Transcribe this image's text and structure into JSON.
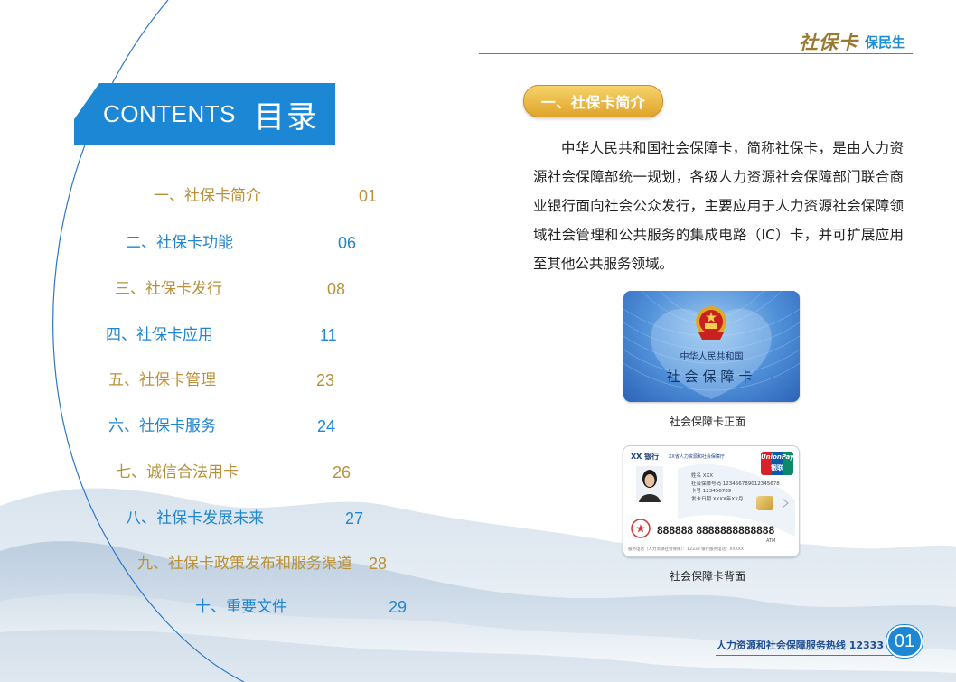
{
  "header": {
    "brand_script": "社保卡",
    "brand_tag": "保民生"
  },
  "contents": {
    "title_en": "CONTENTS",
    "title_zh": "目录",
    "items": [
      {
        "title": "一、社保卡简介",
        "page": "01",
        "color": "gold"
      },
      {
        "title": "二、社保卡功能",
        "page": "06",
        "color": "blue"
      },
      {
        "title": "三、社保卡发行",
        "page": "08",
        "color": "gold"
      },
      {
        "title": "四、社保卡应用",
        "page": "11",
        "color": "blue"
      },
      {
        "title": "五、社保卡管理",
        "page": "23",
        "color": "gold"
      },
      {
        "title": "六、社保卡服务",
        "page": "24",
        "color": "blue"
      },
      {
        "title": "七、诚信合法用卡",
        "page": "26",
        "color": "gold"
      },
      {
        "title": "八、社保卡发展未来",
        "page": "27",
        "color": "blue"
      },
      {
        "title": "九、社保卡政策发布和服务渠道",
        "page": "28",
        "color": "gold"
      },
      {
        "title": "十、重要文件",
        "page": "29",
        "color": "blue"
      }
    ]
  },
  "section": {
    "heading": "一、社保卡简介",
    "paragraph": "中华人民共和国社会保障卡，简称社保卡，是由人力资源社会保障部统一规划，各级人力资源社会保障部门联合商业银行面向社会公众发行，主要应用于人力资源社会保障领域社会管理和公共服务的集成电路（IC）卡，并可扩展应用至其他公共服务领域。"
  },
  "card_front": {
    "line1": "中华人民共和国",
    "line2": "社会保障卡",
    "caption": "社会保障卡正面"
  },
  "card_back": {
    "bank": "XX 银行",
    "issuer": "XX省人力资源和社会保障厅",
    "logo_top": "UnionPay",
    "logo_bottom": "银联",
    "info": [
      "姓名 XXX",
      "社会保障号码 123456789012345678",
      "卡号 123456789",
      "发卡日期 XXXX年XX月"
    ],
    "number": "888888 8888888888888",
    "atm": "ATM",
    "footer": "服务电话（人力资源社会保障）：12333   银行服务电话：XXXXX",
    "caption": "社会保障卡背面"
  },
  "footer": {
    "hotline": "人力资源和社会保障服务热线 12333",
    "page": "01"
  },
  "colors": {
    "blue": "#1c87d4",
    "gold": "#b8913a",
    "pill": "#e6ad33"
  }
}
